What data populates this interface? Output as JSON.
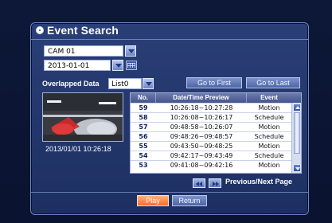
{
  "window": {
    "title": "Event Search"
  },
  "filters": {
    "camera": "CAM 01",
    "date": "2013-01-01",
    "overlapped_label": "Overlapped Data",
    "overlapped_value": "List0"
  },
  "actions": {
    "go_first": "Go to First",
    "go_last": "Go to Last"
  },
  "preview": {
    "timestamp": "2013/01/01 10:26:18"
  },
  "table": {
    "headers": {
      "no": "No.",
      "datetime": "Date/Time Preview",
      "event": "Event"
    },
    "rows": [
      {
        "no": "59",
        "datetime": "10:26:18~10:27:28",
        "event": "Motion"
      },
      {
        "no": "58",
        "datetime": "10:26:08~10:26:17",
        "event": "Schedule"
      },
      {
        "no": "57",
        "datetime": "09:48:58~10:26:07",
        "event": "Motion"
      },
      {
        "no": "56",
        "datetime": "09:48:26~09:48:57",
        "event": "Schedule"
      },
      {
        "no": "55",
        "datetime": "09:43:50~09:48:25",
        "event": "Motion"
      },
      {
        "no": "54",
        "datetime": "09:42:17~09:43:49",
        "event": "Schedule"
      },
      {
        "no": "53",
        "datetime": "09:41:08~09:42:16",
        "event": "Motion"
      }
    ]
  },
  "pagination": {
    "label": "Previous/Next Page"
  },
  "buttons": {
    "play": "Play",
    "return": "Return"
  }
}
